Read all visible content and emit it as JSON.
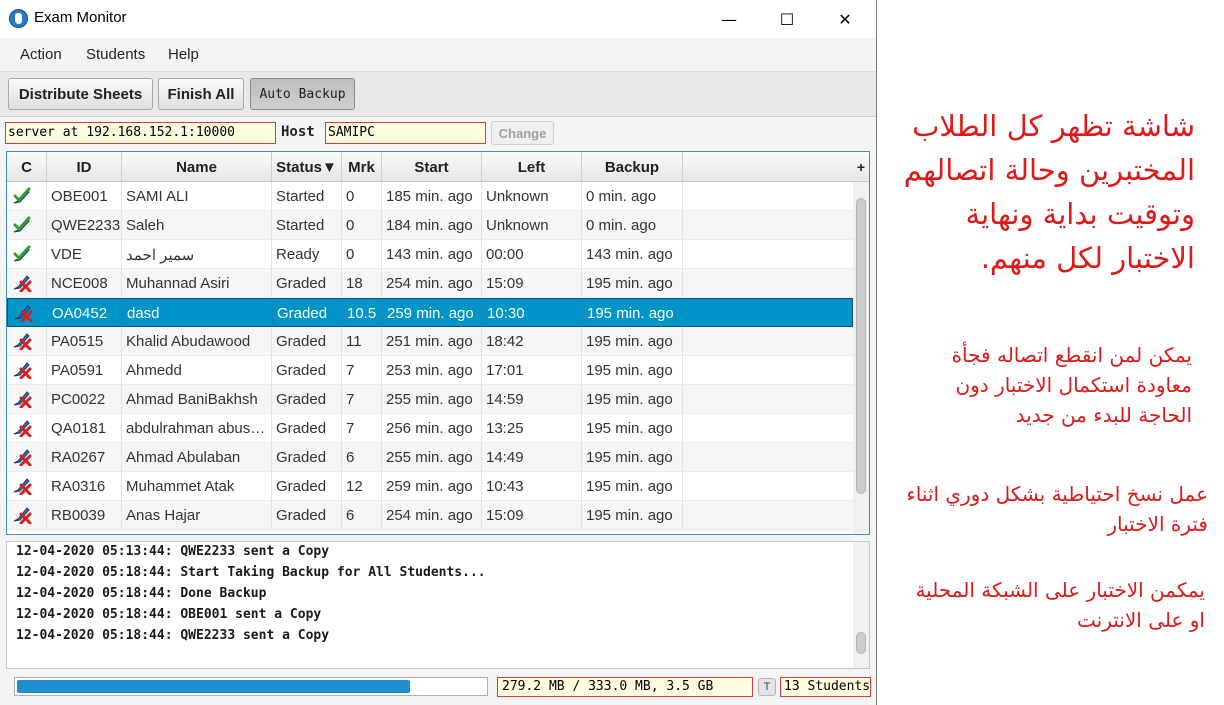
{
  "window": {
    "title": "Exam Monitor",
    "controls": {
      "minimize": "—",
      "maximize": "☐",
      "close": "✕"
    }
  },
  "menu": [
    "Action",
    "Students",
    "Help"
  ],
  "toolbar": {
    "distribute_label": "Distribute Sheets",
    "finish_label": "Finish All",
    "backup_label": "Auto Backup"
  },
  "connection": {
    "server_value": "server at 192.168.152.1:10000",
    "host_label": "Host",
    "host_value": "SAMIPC",
    "change_label": "Change"
  },
  "table": {
    "columns": [
      "C",
      "ID",
      "Name",
      "Status▼",
      "Mrk",
      "Start",
      "Left",
      "Backup"
    ],
    "add_column": "+",
    "rows": [
      {
        "icon": "check-icon",
        "id": "OBE001",
        "name": "SAMI ALI",
        "status": "Started",
        "mark": "0",
        "start": "185 min. ago",
        "left": "Unknown",
        "backup": "0 min. ago"
      },
      {
        "icon": "check-icon",
        "id": "QWE2233",
        "name": "Saleh",
        "status": "Started",
        "mark": "0",
        "start": "184 min. ago",
        "left": "Unknown",
        "backup": "0 min. ago"
      },
      {
        "icon": "check-icon",
        "id": "VDE",
        "name": "سمير احمد",
        "status": "Ready",
        "mark": "0",
        "start": "143 min. ago",
        "left": "00:00",
        "backup": "143 min. ago"
      },
      {
        "icon": "x-icon",
        "id": "NCE008",
        "name": "Muhannad Asiri",
        "status": "Graded",
        "mark": "18",
        "start": "254 min. ago",
        "left": "15:09",
        "backup": "195 min. ago"
      },
      {
        "icon": "x-icon",
        "id": "OA0452",
        "name": "dasd",
        "status": "Graded",
        "mark": "10.5",
        "start": "259 min. ago",
        "left": "10:30",
        "backup": "195 min. ago",
        "selected": true
      },
      {
        "icon": "x-icon",
        "id": "PA0515",
        "name": "Khalid Abudawood",
        "status": "Graded",
        "mark": "11",
        "start": "251 min. ago",
        "left": "18:42",
        "backup": "195 min. ago"
      },
      {
        "icon": "x-icon",
        "id": "PA0591",
        "name": "Ahmedd",
        "status": "Graded",
        "mark": "7",
        "start": "253 min. ago",
        "left": "17:01",
        "backup": "195 min. ago"
      },
      {
        "icon": "x-icon",
        "id": "PC0022",
        "name": "Ahmad BaniBakhsh",
        "status": "Graded",
        "mark": "7",
        "start": "255 min. ago",
        "left": "14:59",
        "backup": "195 min. ago"
      },
      {
        "icon": "x-icon",
        "id": "QA0181",
        "name": "abdulrahman abus…",
        "status": "Graded",
        "mark": "7",
        "start": "256 min. ago",
        "left": "13:25",
        "backup": "195 min. ago"
      },
      {
        "icon": "x-icon",
        "id": "RA0267",
        "name": "Ahmad Abulaban",
        "status": "Graded",
        "mark": "6",
        "start": "255 min. ago",
        "left": "14:49",
        "backup": "195 min. ago"
      },
      {
        "icon": "x-icon",
        "id": "RA0316",
        "name": "Muhammet Atak",
        "status": "Graded",
        "mark": "12",
        "start": "259 min. ago",
        "left": "10:43",
        "backup": "195 min. ago"
      },
      {
        "icon": "x-icon",
        "id": "RB0039",
        "name": "Anas Hajar",
        "status": "Graded",
        "mark": "6",
        "start": "254 min. ago",
        "left": "15:09",
        "backup": "195 min. ago"
      }
    ]
  },
  "log": [
    "12-04-2020 05:13:44: QWE2233 sent a Copy",
    "12-04-2020 05:18:44: Start Taking Backup for All Students...",
    "12-04-2020 05:18:44: Done Backup",
    "12-04-2020 05:18:44: OBE001 sent a Copy",
    "12-04-2020 05:18:44: QWE2233 sent a Copy"
  ],
  "statusbar": {
    "progress": 0.84,
    "disk": "279.2 MB / 333.0 MB, 3.5 GB",
    "t_label": "T",
    "students": "13 Students"
  },
  "annotations": [
    "شاشة تظهر كل الطلاب المختبرين وحالة اتصالهم وتوقيت بداية ونهاية الاختبار لكل منهم.",
    "يمكن لمن انقطع اتصاله فجأة معاودة استكمال الاختبار دون الحاجة للبدء من جديد",
    "عمل نسخ احتياطية بشكل دوري اثناء فترة الاختبار",
    "يمكمن الاختبار على الشبكة المحلية او على الانترنت"
  ],
  "colors": {
    "selection": "#0095c9",
    "annotation": "#e01818",
    "progress": "#1e8fd0",
    "field_border": "#d04040"
  }
}
